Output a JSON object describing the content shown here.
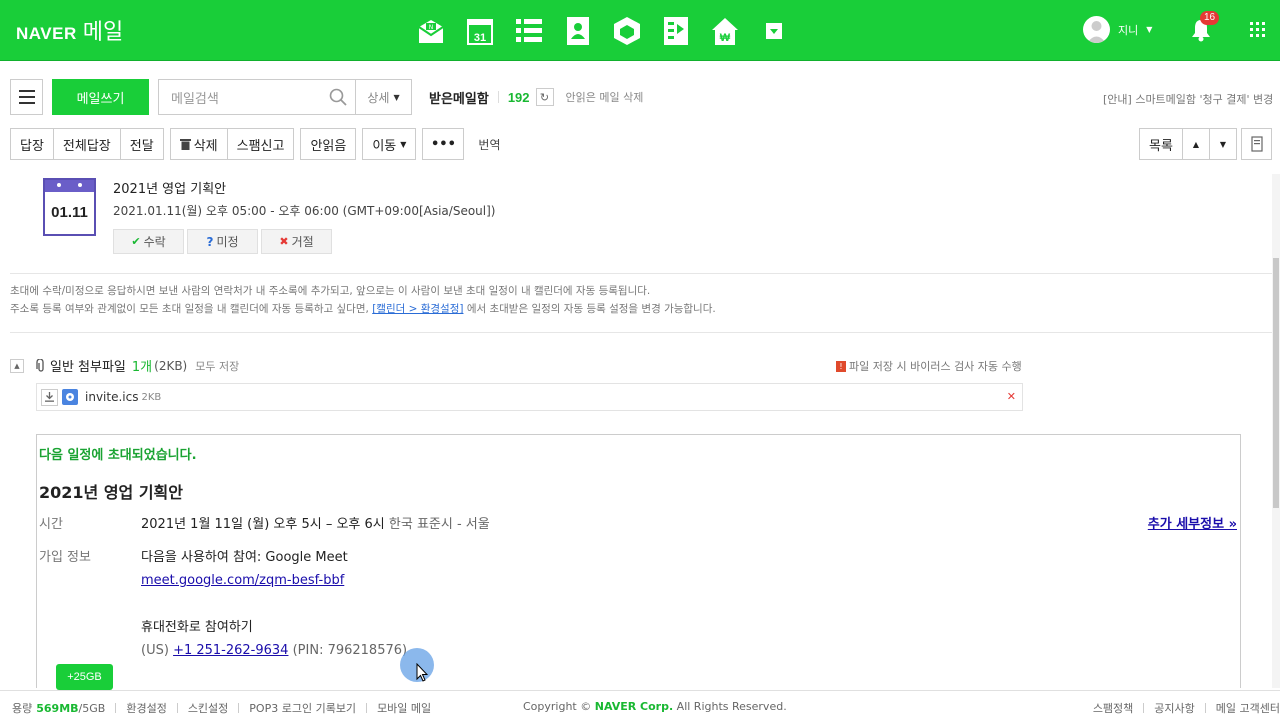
{
  "header": {
    "logo_brand": "NAVER",
    "logo_service": "메일",
    "service_icons": [
      "mail-inbox-icon",
      "calendar-icon",
      "list-icon",
      "contacts-icon",
      "box-icon",
      "memo-icon",
      "home-pay-icon",
      "more-dropdown-icon"
    ],
    "calendar_icon_num": "31",
    "user_name": "지니",
    "notification_count": "16"
  },
  "toolbar1": {
    "write_label": "메일쓰기",
    "search_placeholder": "메일검색",
    "detail_label": "상세",
    "folder_title": "받은메일함",
    "mail_count": "192",
    "delete_unread": "안읽은 메일 삭제",
    "notice": "[안내] 스마트메일함 '청구 결제' 변경"
  },
  "toolbar2": {
    "reply": "답장",
    "reply_all": "전체답장",
    "forward": "전달",
    "delete": "삭제",
    "spam": "스팸신고",
    "unread": "안읽음",
    "move": "이동",
    "more": "•••",
    "translate": "번역",
    "list": "목록"
  },
  "event": {
    "date_badge": "01.11",
    "title": "2021년 영업 기획안",
    "time": "2021.01.11(월) 오후 05:00 - 오후 06:00 (GMT+09:00[Asia/Seoul])",
    "accept": "수락",
    "maybe": "미정",
    "decline": "거절"
  },
  "info": {
    "line1": "초대에 수락/미정으로 응답하시면 보낸 사람의 연락처가 내 주소록에 추가되고, 앞으로는 이 사람이 보낸 초대 일정이 내 캘린더에 자동 등록됩니다.",
    "line2_pre": "주소록 등록 여부와 관계없이 모든 초대 일정을 내 캘린더에 자동 등록하고 싶다면,",
    "line2_link": "[캘린더 > 환경설정]",
    "line2_post": "에서 초대받은 일정의 자동 등록 설정을 변경 가능합니다."
  },
  "attachment": {
    "title": "일반 첨부파일",
    "count": "1개",
    "size": "(2KB)",
    "save_all": "모두 저장",
    "virus_notice": "파일 저장 시 바이러스 검사 자동 수행",
    "file_name": "invite.ics",
    "file_size": "2KB"
  },
  "mail_body": {
    "invited": "다음 일정에 초대되었습니다.",
    "title": "2021년 영업 기획안",
    "time_label": "시간",
    "time_value": "2021년 1월 11일 (월) 오후 5시 – 오후 6시",
    "time_zone": "한국 표준시 - 서울",
    "more_details": "추가 세부정보 »",
    "join_label": "가입 정보",
    "join_value": "다음을 사용하여 참여: Google Meet",
    "meet_link": "meet.google.com/zqm-besf-bbf",
    "phone_title": "휴대전화로 참여하기",
    "phone_country": "(US)",
    "phone_number": "+1 251-262-9634",
    "phone_pin": "(PIN: 796218576)"
  },
  "storage_badge": "+25GB",
  "footer": {
    "usage_label": "용량",
    "usage_used": "569MB",
    "usage_total": "/5GB",
    "settings": "환경설정",
    "skin": "스킨설정",
    "pop3": "POP3 로그인 기록보기",
    "mobile": "모바일 메일",
    "copyright_pre": "Copyright ©",
    "copyright_corp": "NAVER Corp.",
    "copyright_post": "All Rights Reserved.",
    "spam_policy": "스팸정책",
    "notice": "공지사항",
    "support": "메일 고객센터"
  },
  "colors": {
    "brand_green": "#19ce39",
    "calendar_purple": "#5a4fb3",
    "link_blue": "#1a0dab"
  }
}
